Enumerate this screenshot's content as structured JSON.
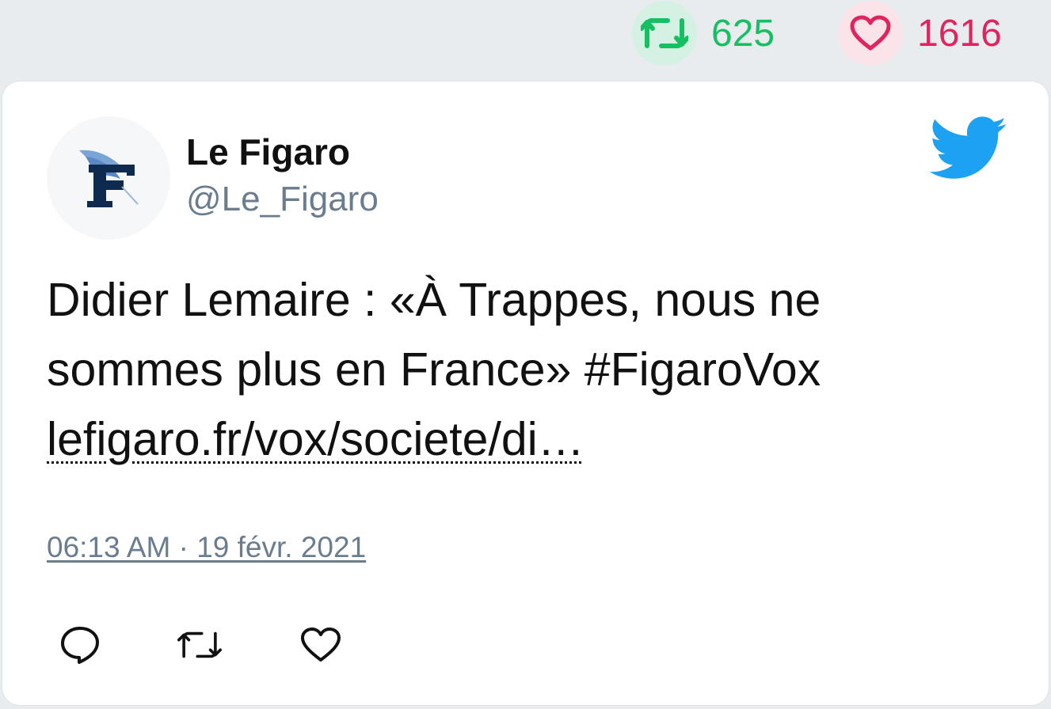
{
  "stats": {
    "retweet_count": "625",
    "like_count": "1616",
    "retweet_icon": "retweet-icon",
    "like_icon": "heart-icon",
    "retweet_color": "#17bf63",
    "like_color": "#e0245e"
  },
  "tweet": {
    "author": {
      "display_name": "Le Figaro",
      "handle": "@Le_Figaro",
      "avatar_icon": "le-figaro-logo"
    },
    "text_line1": "Didier Lemaire : «À Trappes, nous ne",
    "text_line2": "sommes plus en France» #FigaroVox",
    "link": "lefigaro.fr/vox/societe/di…",
    "timestamp": "06:13 AM · 19 févr. 2021",
    "brand_icon": "twitter-bird-icon",
    "brand_color": "#1da1f2"
  },
  "actions": {
    "reply_icon": "reply-icon",
    "retweet_icon": "retweet-icon",
    "like_icon": "heart-icon"
  }
}
